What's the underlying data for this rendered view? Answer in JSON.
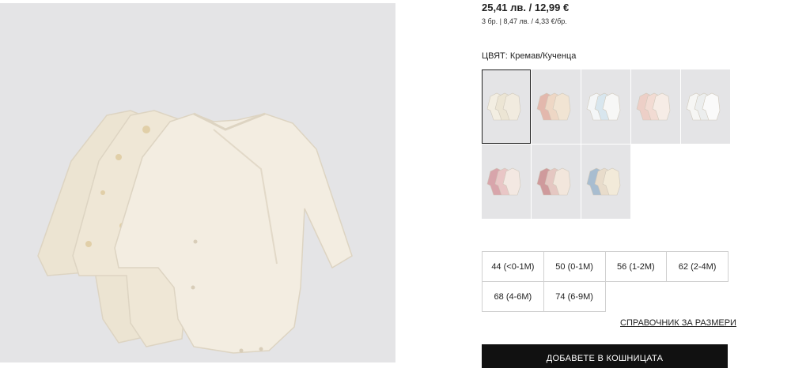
{
  "product": {
    "price": "25,41 лв. / 12,99 €",
    "unit_price": "3 бр. | 8,47 лв. / 4,33 €/бр.",
    "image_alt": "Product image - cream bodysuits",
    "image_colors": {
      "background": "#e4e4e6",
      "garment": "#f1ebdd",
      "shadow": "#ddd4c2"
    }
  },
  "color_selector": {
    "label": "ЦВЯТ: Кремав/Кученца",
    "swatches": [
      {
        "name": "Кремав/Кученца",
        "selected": true,
        "colors": [
          "#f3eee2",
          "#ece5d4",
          "#f1ebdf"
        ]
      },
      {
        "name": "Pink/beige",
        "selected": false,
        "colors": [
          "#e3b8ad",
          "#eed7c5",
          "#f1e4d3"
        ]
      },
      {
        "name": "White/blue",
        "selected": false,
        "colors": [
          "#f4f6f7",
          "#d8e6ee",
          "#f7f7f6"
        ]
      },
      {
        "name": "Light pink",
        "selected": false,
        "colors": [
          "#edcfc7",
          "#f2dbd3",
          "#f6ece6"
        ]
      },
      {
        "name": "White",
        "selected": false,
        "colors": [
          "#f6f6f4",
          "#eceeee",
          "#fafafa"
        ]
      },
      {
        "name": "Dusty rose",
        "selected": false,
        "colors": [
          "#d8a5ab",
          "#e9c6c6",
          "#f3e8e2"
        ]
      },
      {
        "name": "Pink mix",
        "selected": false,
        "colors": [
          "#cf9a9c",
          "#e5c7c2",
          "#f2e6dc"
        ]
      },
      {
        "name": "Blue/beige",
        "selected": false,
        "colors": [
          "#a8bdd0",
          "#e8dccb",
          "#f2ead9"
        ]
      }
    ]
  },
  "size_selector": {
    "sizes": [
      "44 (<0-1M)",
      "50 (0-1M)",
      "56 (1-2M)",
      "62 (2-4M)",
      "68 (4-6M)",
      "74 (6-9M)"
    ]
  },
  "size_guide_link": "СПРАВОЧНИК ЗА РАЗМЕРИ",
  "add_to_cart": "ДОБАВЕТЕ В КОШНИЦАТА"
}
